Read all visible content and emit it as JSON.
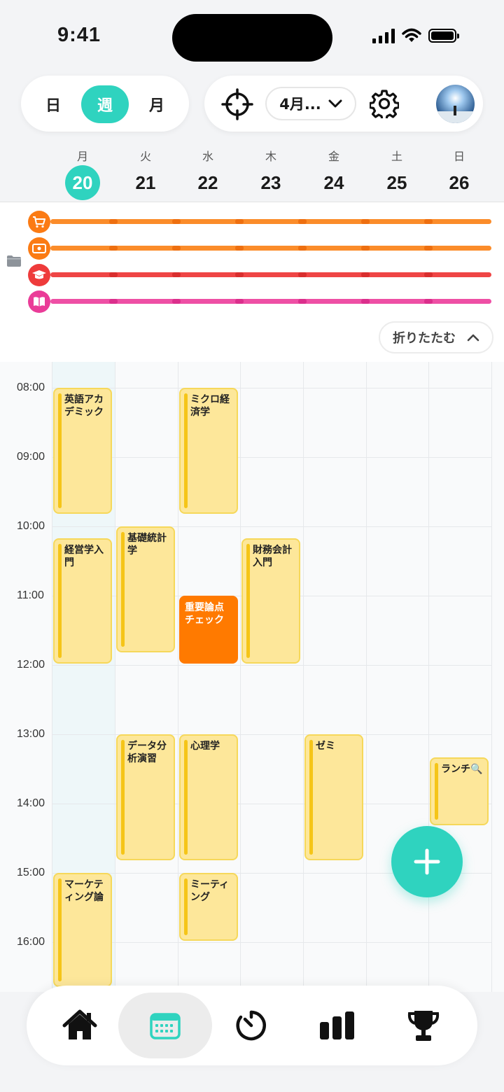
{
  "status_bar": {
    "time": "9:41"
  },
  "view_switch": {
    "day": "日",
    "week": "週",
    "month": "月",
    "active": "week"
  },
  "toolbar": {
    "month_select": "4月..."
  },
  "week": {
    "days": [
      {
        "dow": "月",
        "date": "20",
        "today": true
      },
      {
        "dow": "火",
        "date": "21"
      },
      {
        "dow": "水",
        "date": "22"
      },
      {
        "dow": "木",
        "date": "23"
      },
      {
        "dow": "金",
        "date": "24"
      },
      {
        "dow": "土",
        "date": "25"
      },
      {
        "dow": "日",
        "date": "26"
      }
    ]
  },
  "routines": {
    "items": [
      {
        "icon": "cart-icon",
        "color": "#fb8c2a"
      },
      {
        "icon": "money-icon",
        "color": "#fb8c2a"
      },
      {
        "icon": "graduation-cap-icon",
        "color": "#ef4545"
      },
      {
        "icon": "book-icon",
        "color": "#ee4fa5"
      }
    ],
    "collapse_label": "折りたたむ"
  },
  "hours": [
    "08:00",
    "09:00",
    "10:00",
    "11:00",
    "12:00",
    "13:00",
    "14:00",
    "15:00",
    "16:00"
  ],
  "events": [
    {
      "day": 0,
      "start": "08:00",
      "end": "09:50",
      "title": "英語アカデミック"
    },
    {
      "day": 0,
      "start": "10:10",
      "end": "12:00",
      "title": "経営学入門"
    },
    {
      "day": 0,
      "start": "15:00",
      "end": "16:40",
      "title": "マーケティング論"
    },
    {
      "day": 1,
      "start": "10:00",
      "end": "11:50",
      "title": "基礎統計学"
    },
    {
      "day": 1,
      "start": "13:00",
      "end": "14:50",
      "title": "データ分析演習"
    },
    {
      "day": 2,
      "start": "08:00",
      "end": "09:50",
      "title": "ミクロ経済学"
    },
    {
      "day": 2,
      "start": "11:00",
      "end": "12:00",
      "title": "重要論点チェック",
      "highlight": true
    },
    {
      "day": 2,
      "start": "13:00",
      "end": "14:50",
      "title": "心理学"
    },
    {
      "day": 2,
      "start": "15:00",
      "end": "16:00",
      "title": "ミーティング"
    },
    {
      "day": 3,
      "start": "10:10",
      "end": "12:00",
      "title": "財務会計入門"
    },
    {
      "day": 4,
      "start": "13:00",
      "end": "14:50",
      "title": "ゼミ"
    },
    {
      "day": 6,
      "start": "13:20",
      "end": "14:20",
      "title": "ランチ🔍"
    }
  ],
  "colors": {
    "accent": "#2fd3bf",
    "event_bg": "#fde79a",
    "event_bar": "#f5c518",
    "highlight": "#ff7a00"
  },
  "tabbar": {
    "items": [
      {
        "icon": "home-icon"
      },
      {
        "icon": "calendar-icon",
        "active": true
      },
      {
        "icon": "timer-icon"
      },
      {
        "icon": "bar-chart-icon"
      },
      {
        "icon": "trophy-icon"
      }
    ]
  }
}
